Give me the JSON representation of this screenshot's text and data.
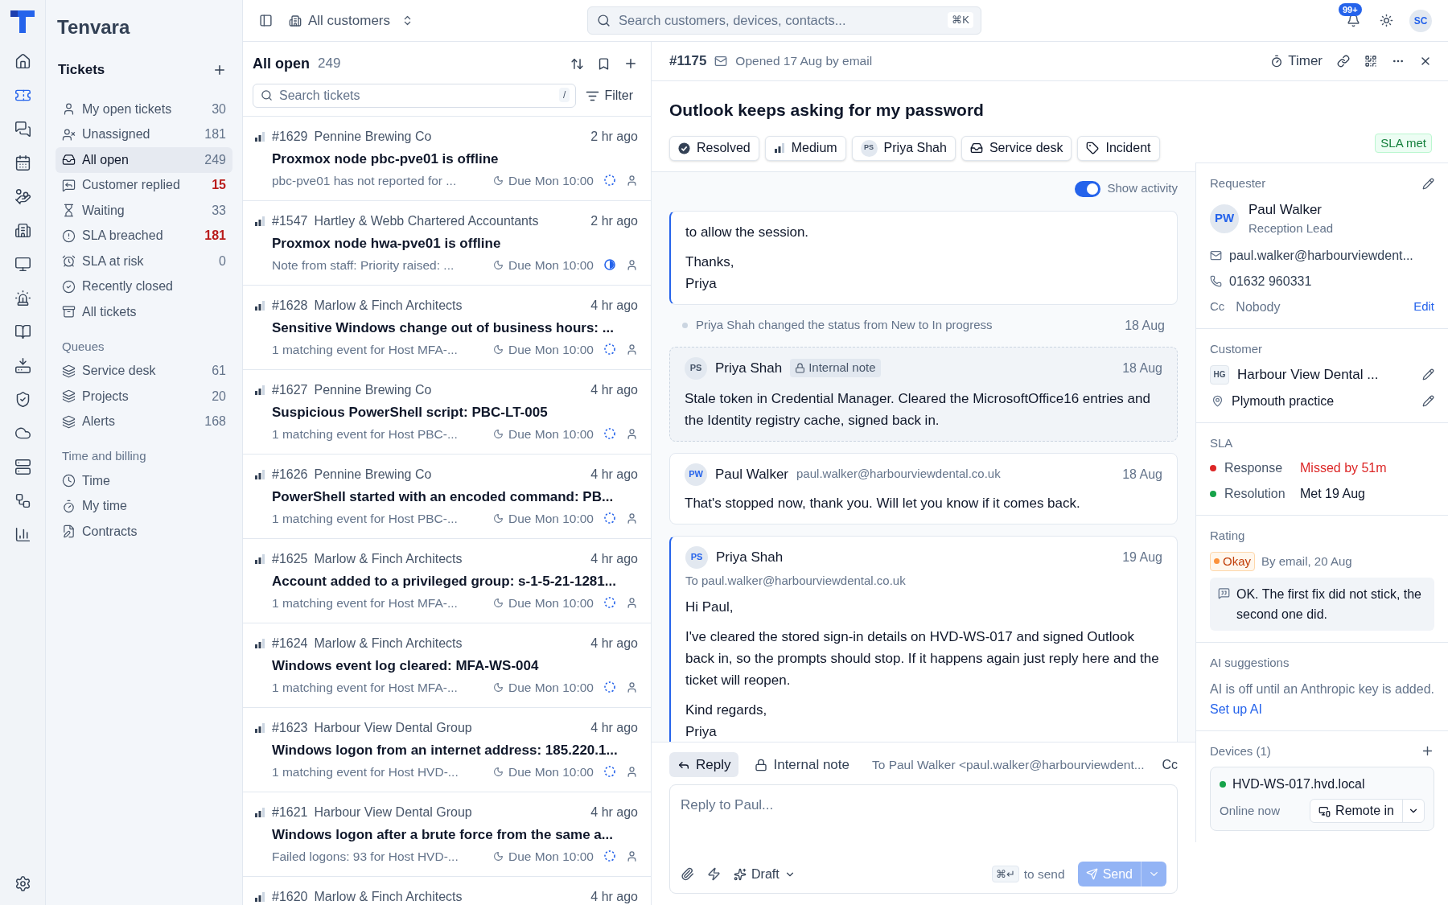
{
  "brand": "Tenvara",
  "rail_items": [
    {
      "selected": false
    },
    {
      "selected": true
    },
    {
      "selected": false
    },
    {
      "selected": false
    },
    {
      "selected": false
    },
    {
      "selected": false
    },
    {
      "selected": false
    },
    {
      "selected": false
    },
    {
      "selected": false
    },
    {
      "selected": false
    },
    {
      "selected": false
    },
    {
      "selected": false
    },
    {
      "selected": false
    },
    {
      "selected": false
    },
    {
      "selected": false
    }
  ],
  "sidebar": {
    "title": "Tickets",
    "views": [
      {
        "label": "My open tickets",
        "count": "30",
        "alert": false,
        "selected": false
      },
      {
        "label": "Unassigned",
        "count": "181",
        "alert": false,
        "selected": false
      },
      {
        "label": "All open",
        "count": "249",
        "alert": false,
        "selected": true
      },
      {
        "label": "Customer replied",
        "count": "15",
        "alert": true,
        "selected": false
      },
      {
        "label": "Waiting",
        "count": "33",
        "alert": false,
        "selected": false
      },
      {
        "label": "SLA breached",
        "count": "181",
        "alert": true,
        "selected": false
      },
      {
        "label": "SLA at risk",
        "count": "0",
        "alert": false,
        "selected": false
      },
      {
        "label": "Recently closed",
        "selected": false
      },
      {
        "label": "All tickets",
        "selected": false
      }
    ],
    "sections": [
      {
        "heading": "Queues",
        "items": [
          {
            "label": "Service desk",
            "count": "61"
          },
          {
            "label": "Projects",
            "count": "20"
          },
          {
            "label": "Alerts",
            "count": "168"
          }
        ]
      },
      {
        "heading": "Time and billing",
        "items": [
          {
            "label": "Time"
          },
          {
            "label": "My time"
          },
          {
            "label": "Contracts"
          }
        ]
      }
    ]
  },
  "topbar": {
    "scope": "All customers",
    "search_placeholder": "Search customers, devices, contacts...",
    "shortcut": "⌘K",
    "notifications": "99+",
    "avatar": "SC"
  },
  "list": {
    "title": "All open",
    "count": "249",
    "search_placeholder": "Search tickets",
    "search_key": "/",
    "filter": "Filter",
    "tickets": [
      {
        "number": "#1629",
        "customer": "Pennine Brewing Co",
        "time": "2 hr ago",
        "subject": "Proxmox node pbc-pve01 is offline",
        "preview": "pbc-pve01 has not reported for ...",
        "due": "Due Mon 10:00",
        "sla_half": false
      },
      {
        "number": "#1547",
        "customer": "Hartley & Webb Chartered Accountants",
        "time": "2 hr ago",
        "subject": "Proxmox node hwa-pve01 is offline",
        "preview": "Note from staff: Priority raised: ...",
        "due": "Due Mon 10:00",
        "sla_half": true
      },
      {
        "number": "#1628",
        "customer": "Marlow & Finch Architects",
        "time": "4 hr ago",
        "subject": "Sensitive Windows change out of business hours: ...",
        "preview": "1 matching event for Host MFA-...",
        "due": "Due Mon 10:00",
        "sla_half": false
      },
      {
        "number": "#1627",
        "customer": "Pennine Brewing Co",
        "time": "4 hr ago",
        "subject": "Suspicious PowerShell script: PBC-LT-005",
        "preview": "1 matching event for Host PBC-...",
        "due": "Due Mon 10:00",
        "sla_half": false
      },
      {
        "number": "#1626",
        "customer": "Pennine Brewing Co",
        "time": "4 hr ago",
        "subject": "PowerShell started with an encoded command: PB...",
        "preview": "1 matching event for Host PBC-...",
        "due": "Due Mon 10:00",
        "sla_half": false
      },
      {
        "number": "#1625",
        "customer": "Marlow & Finch Architects",
        "time": "4 hr ago",
        "subject": "Account added to a privileged group: s-1-5-21-1281...",
        "preview": "1 matching event for Host MFA-...",
        "due": "Due Mon 10:00",
        "sla_half": false
      },
      {
        "number": "#1624",
        "customer": "Marlow & Finch Architects",
        "time": "4 hr ago",
        "subject": "Windows event log cleared: MFA-WS-004",
        "preview": "1 matching event for Host MFA-...",
        "due": "Due Mon 10:00",
        "sla_half": false
      },
      {
        "number": "#1623",
        "customer": "Harbour View Dental Group",
        "time": "4 hr ago",
        "subject": "Windows logon from an internet address: 185.220.1...",
        "preview": "1 matching event for Host HVD-...",
        "due": "Due Mon 10:00",
        "sla_half": false
      },
      {
        "number": "#1621",
        "customer": "Harbour View Dental Group",
        "time": "4 hr ago",
        "subject": "Windows logon after a brute force from the same a...",
        "preview": "Failed logons: 93 for Host HVD-...",
        "due": "Due Mon 10:00",
        "sla_half": false
      },
      {
        "number": "#1620",
        "customer": "Marlow & Finch Architects",
        "time": "4 hr ago"
      }
    ]
  },
  "ticket": {
    "number": "#1175",
    "opened": "Opened 17 Aug by email",
    "timer": "Timer",
    "subject": "Outlook keeps asking for my password",
    "sla_badge": "SLA met",
    "chips": [
      {
        "kind": "status",
        "label": "Resolved"
      },
      {
        "kind": "priority",
        "label": "Medium"
      },
      {
        "kind": "assignee",
        "initials": "PS",
        "label": "Priya Shah"
      },
      {
        "kind": "queue",
        "label": "Service desk"
      },
      {
        "kind": "type",
        "label": "Incident"
      }
    ],
    "show_activity": {
      "label": "Show activity",
      "on": true
    },
    "thread": [
      {
        "kind": "message",
        "outbound": true,
        "paragraphs": [
          "to allow the session.",
          "Thanks,\nPriya"
        ]
      },
      {
        "kind": "event",
        "text": "Priya Shah changed the status from New to In progress",
        "date": "18 Aug"
      },
      {
        "kind": "note",
        "initials": "PS",
        "author": "Priya Shah",
        "badge": "Internal note",
        "date": "18 Aug",
        "paragraphs": [
          "Stale token in Credential Manager. Cleared the MicrosoftOffice16 entries and the Identity registry cache, signed back in."
        ]
      },
      {
        "kind": "message",
        "outbound": false,
        "initials": "PW",
        "author": "Paul Walker",
        "email": "paul.walker@harbourviewdental.co.uk",
        "date": "18 Aug",
        "paragraphs": [
          "That's stopped now, thank you. Will let you know if it comes back."
        ]
      },
      {
        "kind": "message",
        "outbound": true,
        "initials": "PS",
        "author": "Priya Shah",
        "to": "To paul.walker@harbourviewdental.co.uk",
        "date": "19 Aug",
        "paragraphs": [
          "Hi Paul,",
          "I've cleared the stored sign-in details on HVD-WS-017 and signed Outlook back in, so the prompts should stop. If it happens again just reply here and the ticket will reopen.",
          "Kind regards,\nPriya"
        ]
      }
    ],
    "composer": {
      "tabs": [
        {
          "label": "Reply",
          "selected": true
        },
        {
          "label": "Internal note",
          "selected": false
        }
      ],
      "to": "To Paul Walker <paul.walker@harbourviewdent...",
      "cc": "Cc",
      "placeholder": "Reply to Paul...",
      "draft": "Draft",
      "shortcut": "⌘↵",
      "shortcut_hint": "to send",
      "send": "Send",
      "send_disabled": true
    }
  },
  "details": {
    "requester": {
      "heading": "Requester",
      "initials": "PW",
      "name": "Paul Walker",
      "role": "Reception Lead",
      "email": "paul.walker@harbourviewdent...",
      "phone": "01632 960331",
      "cc_label": "Cc",
      "cc_value": "Nobody",
      "cc_action": "Edit"
    },
    "customer": {
      "heading": "Customer",
      "initials": "HG",
      "name": "Harbour View Dental ...",
      "site": "Plymouth practice"
    },
    "sla": {
      "heading": "SLA",
      "rows": [
        {
          "label": "Response",
          "value": "Missed by 51m",
          "breached": true
        },
        {
          "label": "Resolution",
          "value": "Met 19 Aug",
          "breached": false
        }
      ]
    },
    "rating": {
      "heading": "Rating",
      "label": "Okay",
      "source": "By email, 20 Aug",
      "comment": "OK. The first fix did not stick, the second one did."
    },
    "ai": {
      "heading": "AI suggestions",
      "text": "AI is off until an Anthropic key is added.",
      "link": "Set up AI"
    },
    "devices": {
      "heading": "Devices (1)",
      "items": [
        {
          "name": "HVD-WS-017.hvd.local",
          "online": true,
          "status": "Online now",
          "action": "Remote in"
        }
      ]
    }
  }
}
